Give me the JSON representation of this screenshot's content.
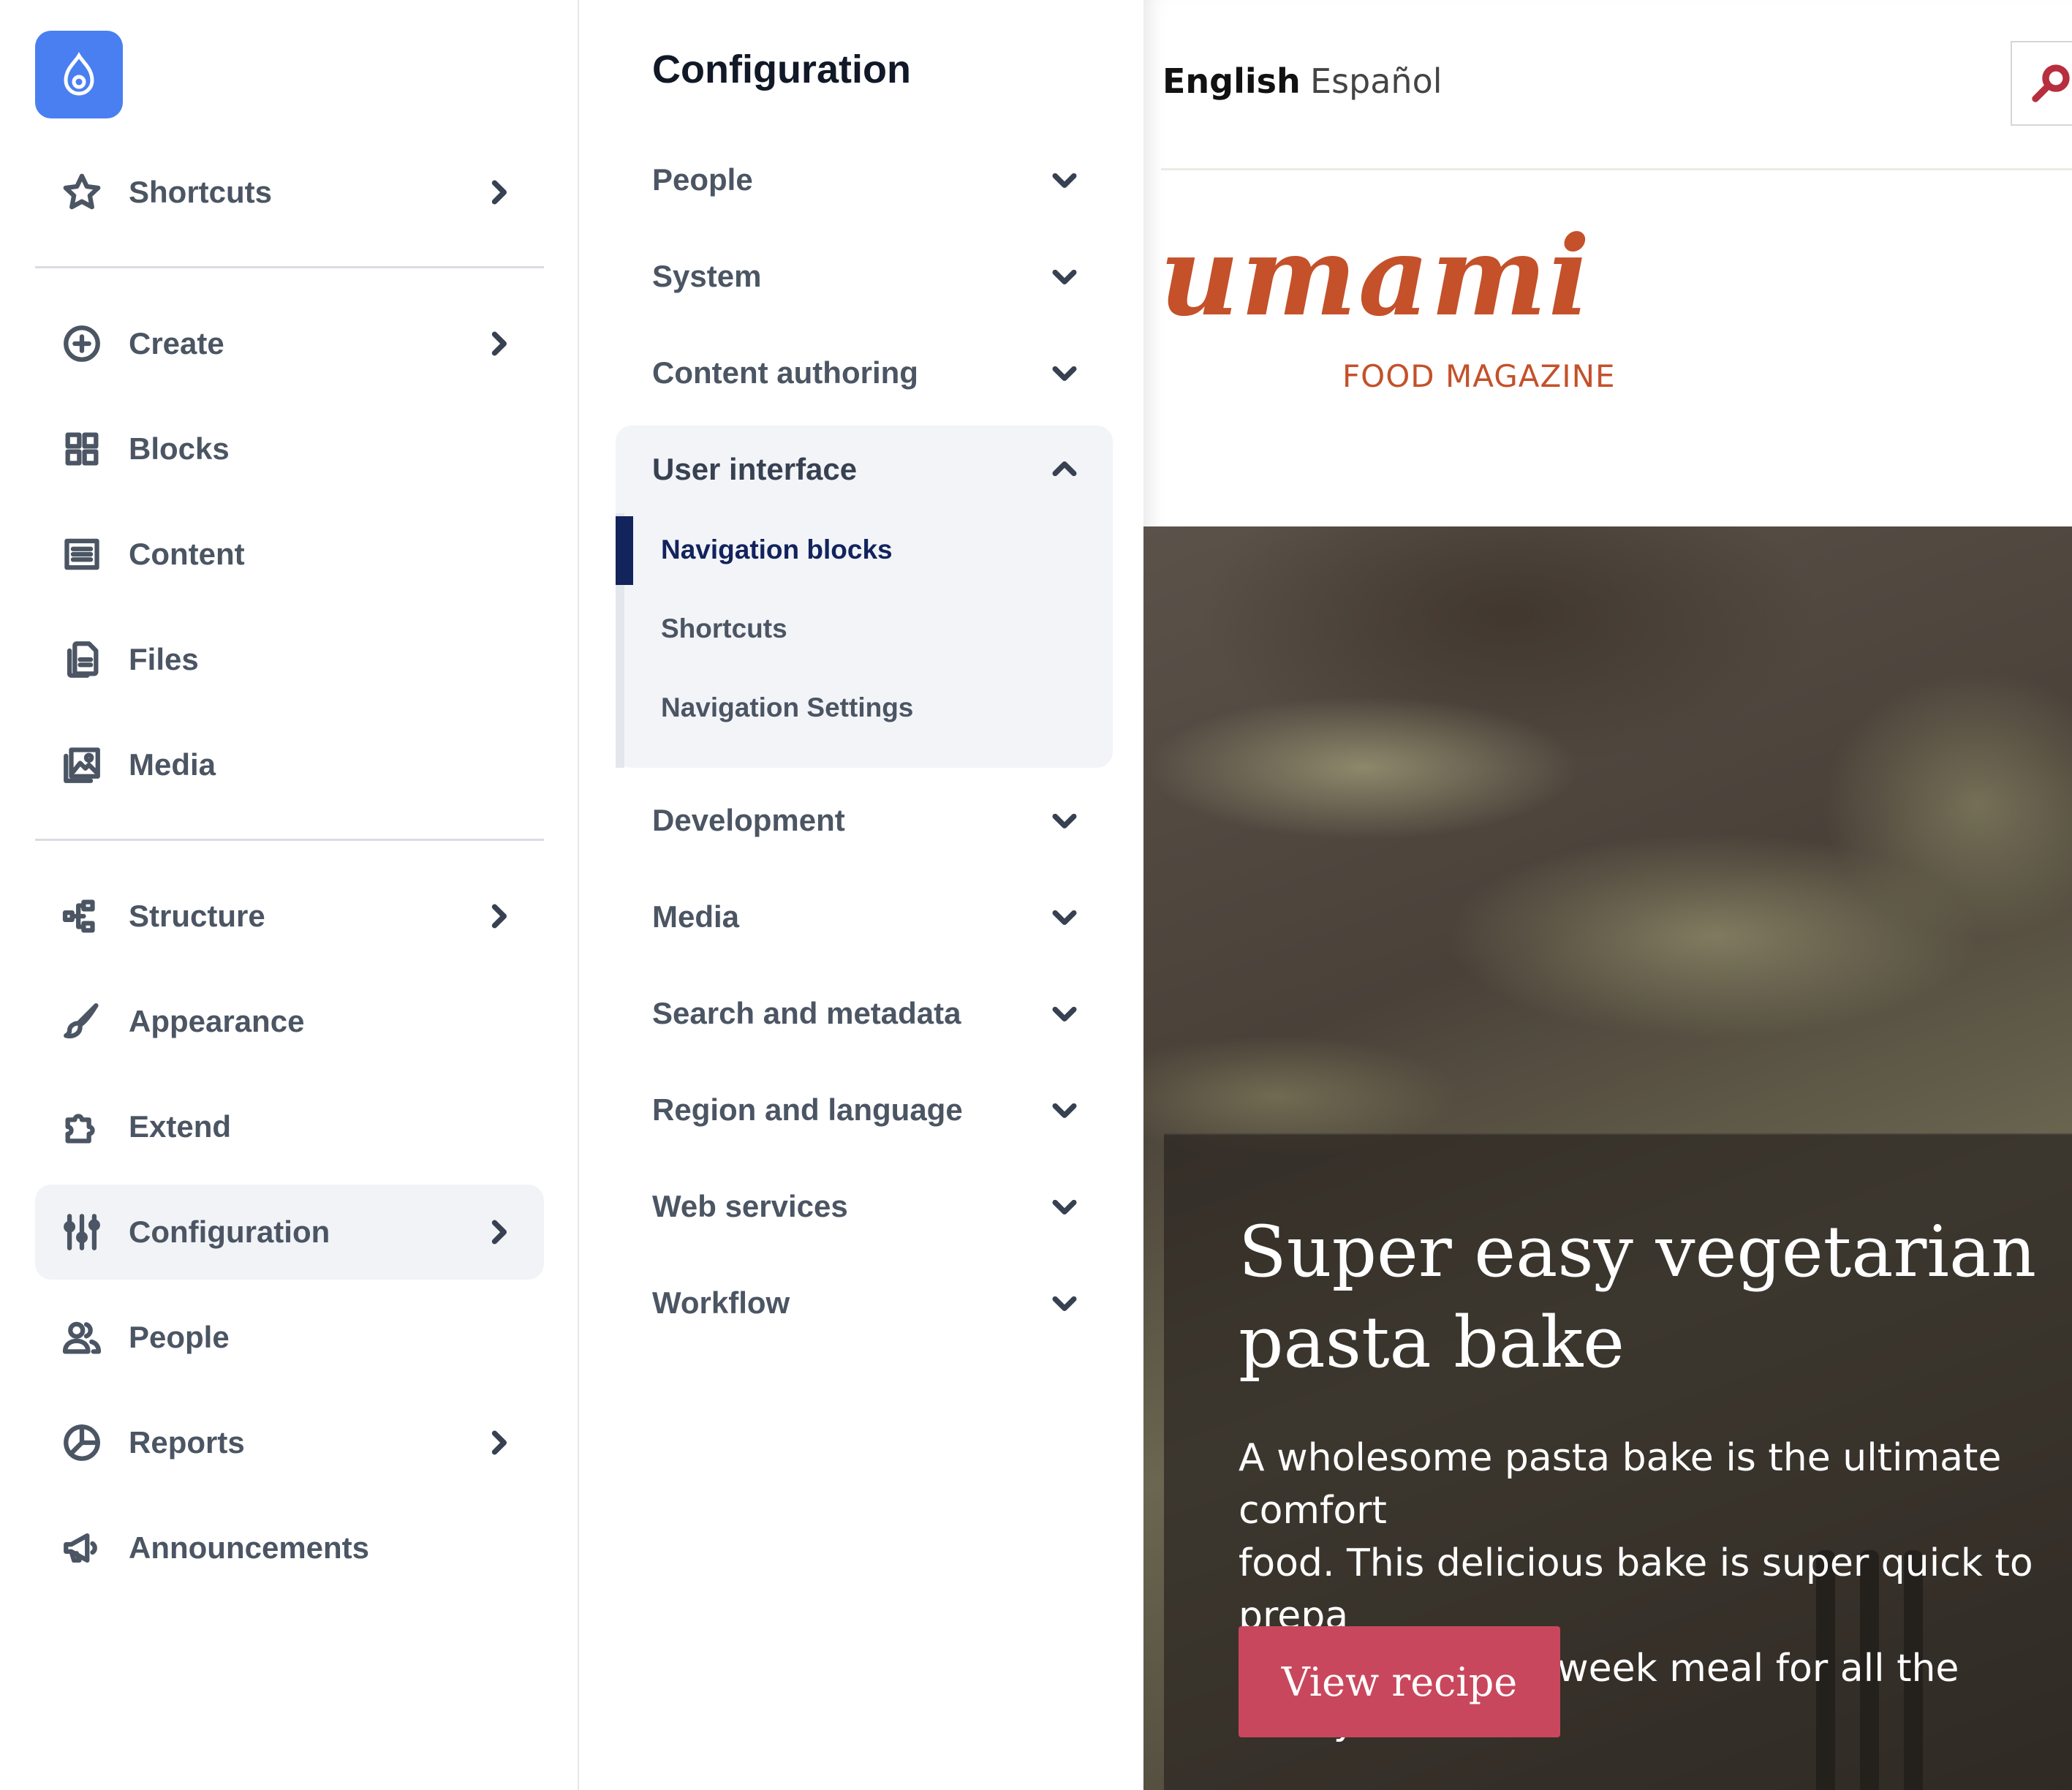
{
  "sidebar": {
    "logo_icon": "drupal-drop-icon",
    "brand_color": "#4a7ff2",
    "items": [
      {
        "label": "Shortcuts",
        "icon": "star-icon",
        "has_children": true
      },
      {
        "label": "Create",
        "icon": "plus-circle-icon",
        "has_children": true
      },
      {
        "label": "Blocks",
        "icon": "blocks-grid-icon",
        "has_children": false
      },
      {
        "label": "Content",
        "icon": "content-list-icon",
        "has_children": false
      },
      {
        "label": "Files",
        "icon": "files-icon",
        "has_children": false
      },
      {
        "label": "Media",
        "icon": "media-image-icon",
        "has_children": false
      },
      {
        "label": "Structure",
        "icon": "structure-icon",
        "has_children": true
      },
      {
        "label": "Appearance",
        "icon": "paintbrush-icon",
        "has_children": false
      },
      {
        "label": "Extend",
        "icon": "puzzle-icon",
        "has_children": false
      },
      {
        "label": "Configuration",
        "icon": "sliders-icon",
        "has_children": true,
        "active": true
      },
      {
        "label": "People",
        "icon": "people-icon",
        "has_children": false
      },
      {
        "label": "Reports",
        "icon": "pie-chart-icon",
        "has_children": true
      },
      {
        "label": "Announcements",
        "icon": "megaphone-icon",
        "has_children": false
      }
    ]
  },
  "config_panel": {
    "title": "Configuration",
    "sections": [
      {
        "label": "People",
        "expanded": false
      },
      {
        "label": "System",
        "expanded": false
      },
      {
        "label": "Content authoring",
        "expanded": false
      },
      {
        "label": "User interface",
        "expanded": true,
        "children": [
          {
            "label": "Navigation blocks",
            "active": true
          },
          {
            "label": "Shortcuts",
            "active": false
          },
          {
            "label": "Navigation Settings",
            "active": false
          }
        ]
      },
      {
        "label": "Development",
        "expanded": false
      },
      {
        "label": "Media",
        "expanded": false
      },
      {
        "label": "Search and metadata",
        "expanded": false
      },
      {
        "label": "Region and language",
        "expanded": false
      },
      {
        "label": "Web services",
        "expanded": false
      },
      {
        "label": "Workflow",
        "expanded": false
      }
    ],
    "active_color": "#13235c"
  },
  "site": {
    "languages": [
      {
        "label": "English",
        "active": true
      },
      {
        "label": "Español",
        "active": false
      }
    ],
    "search_icon": "search-icon",
    "brand_name": "umami",
    "brand_tagline": "FOOD MAGAZINE",
    "brand_color": "#c4512a",
    "hero": {
      "title": "Super easy vegetarian pasta bake",
      "text": "A wholesome pasta bake is the ultimate comfort\nfood. This delicious bake is super quick to prepa\nand an ideal midweek meal for all the family.",
      "button_label": "View recipe",
      "button_color": "#c9475d"
    }
  }
}
